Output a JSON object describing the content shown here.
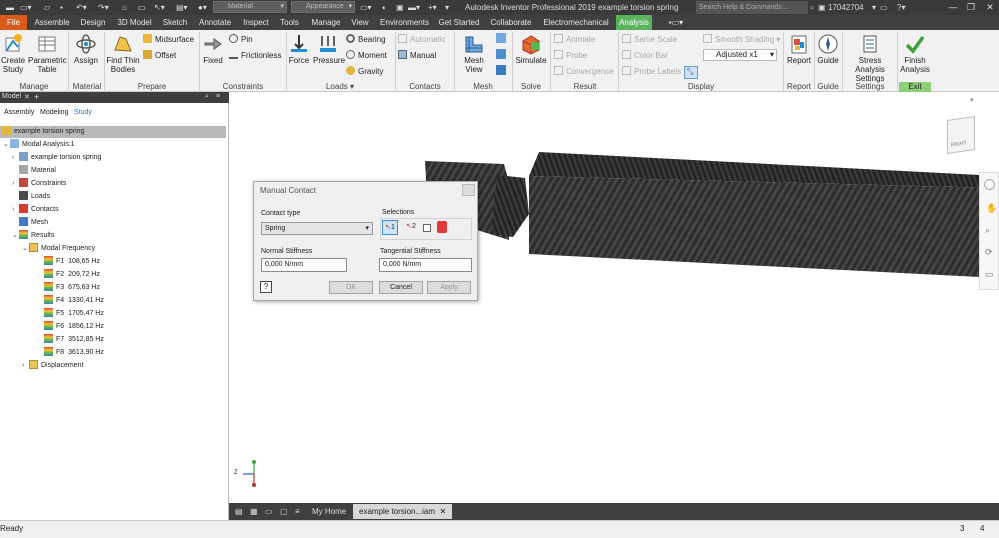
{
  "app": {
    "title": "Autodesk Inventor Professional 2019   example torsion spring",
    "help_search_placeholder": "Search Help & Commands...",
    "user": "17042704",
    "material_combo": "Material",
    "appearance_combo": "Appearance"
  },
  "tabs": [
    "File",
    "Assemble",
    "Design",
    "3D Model",
    "Sketch",
    "Annotate",
    "Inspect",
    "Tools",
    "Manage",
    "View",
    "Environments",
    "Get Started",
    "Collaborate",
    "Electromechanical",
    "Analysis"
  ],
  "ribbon": {
    "manage": {
      "label": "Manage",
      "create_study": "Create Study",
      "parametric_table": "Parametric Table"
    },
    "material": {
      "label": "Material",
      "assign": "Assign"
    },
    "prepare": {
      "label": "Prepare",
      "find_thin_bodies": "Find Thin Bodies",
      "midsurface": "Midsurface",
      "offset": "Offset"
    },
    "constraints": {
      "label": "Constraints",
      "fixed": "Fixed",
      "pin": "Pin",
      "frictionless": "Frictionless"
    },
    "loads": {
      "label": "Loads",
      "force": "Force",
      "pressure": "Pressure",
      "bearing": "Bearing",
      "moment": "Moment",
      "gravity": "Gravity"
    },
    "contacts": {
      "label": "Contacts",
      "automatic": "Automatic",
      "manual": "Manual"
    },
    "mesh": {
      "label": "Mesh",
      "mesh_view": "Mesh View"
    },
    "solve": {
      "label": "Solve",
      "simulate": "Simulate"
    },
    "result": {
      "label": "Result",
      "animate": "Animate",
      "probe": "Probe",
      "convergence": "Convergence"
    },
    "display": {
      "label": "Display",
      "same_scale": "Same Scale",
      "color_bar": "Color Bar",
      "probe_labels": "Probe Labels",
      "smooth_shading": "Smooth Shading",
      "adjusted": "Adjusted x1"
    },
    "report": {
      "label": "Report",
      "report": "Report"
    },
    "guide": {
      "label": "Guide",
      "guide": "Guide"
    },
    "settings": {
      "label": "Settings",
      "stress_analysis_settings": "Stress Analysis Settings"
    },
    "exit": {
      "label": "Exit",
      "finish_analysis": "Finish Analysis"
    }
  },
  "browser": {
    "title": "Model",
    "tabs": [
      "Assembly",
      "Modeling",
      "Study"
    ],
    "root": "example torsion spring",
    "study": "Modal Analysis:1",
    "nodes": [
      "example torsion spring",
      "Material",
      "Constraints",
      "Loads",
      "Contacts",
      "Mesh",
      "Results"
    ],
    "modal_frequency": "Modal Frequency",
    "frequencies": [
      {
        "label": "F1",
        "value": "108,65 Hz"
      },
      {
        "label": "F2",
        "value": "209,72 Hz"
      },
      {
        "label": "F3",
        "value": "675,63 Hz"
      },
      {
        "label": "F4",
        "value": "1330,41 Hz"
      },
      {
        "label": "F5",
        "value": "1705,47 Hz"
      },
      {
        "label": "F6",
        "value": "1856,12 Hz"
      },
      {
        "label": "F7",
        "value": "3512,85 Hz"
      },
      {
        "label": "F8",
        "value": "3613,90 Hz"
      }
    ],
    "displacement": "Displacement"
  },
  "dialog": {
    "title": "Manual Contact",
    "contact_type_label": "Contact type",
    "contact_type_value": "Spring",
    "selections_label": "Selections",
    "selection_1": "1",
    "selection_2": "2",
    "normal_stiffness_label": "Normal Stiffness",
    "normal_stiffness_value": "0,000 N/mm",
    "tangential_stiffness_label": "Tangential Stiffness",
    "tangential_stiffness_value": "0,000 N/mm",
    "ok": "OK",
    "cancel": "Cancel",
    "apply": "Apply"
  },
  "viewcube": {
    "face": "RIGHT"
  },
  "doc_tabs": {
    "home": "My Home",
    "active": "example torsion...iam"
  },
  "status": {
    "text": "Ready",
    "count1": "3",
    "count2": "4"
  },
  "colors": {
    "file_tab": "#d95a1a",
    "analysis_tab": "#59b35a",
    "exit_label": "#8cd07a",
    "study_tab": "#1d75c9"
  }
}
